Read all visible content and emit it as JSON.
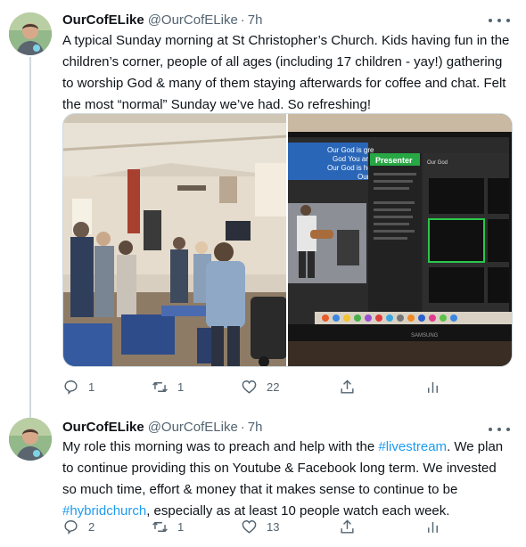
{
  "tweets": [
    {
      "author_name": "OurCofELike",
      "handle": "@OurCofELike",
      "separator": "·",
      "time": "7h",
      "text_lines": [
        "A typical Sunday morning at St Christopher’s Church. Kids having fun in the",
        "children’s corner, people of all ages (including 17 children - yay!) gathering",
        "to worship God & many of them staying afterwards for coffee and chat. Felt",
        "the most “normal” Sunday we’ve had. So refreshing!"
      ],
      "counts": {
        "replies": "1",
        "retweets": "1",
        "likes": "22"
      },
      "media": {
        "right_photo": {
          "screen_lyrics": [
            "Our God is gre",
            "God You are",
            "Our God is he",
            "Our"
          ],
          "presenter_label": "Presenter",
          "panel_label": "Our God",
          "monitor_brand": "SAMSUNG"
        }
      }
    },
    {
      "author_name": "OurCofELike",
      "handle": "@OurCofELike",
      "separator": "·",
      "time": "7h",
      "line1_a": "My role this morning was to preach and help with the ",
      "line1_tag": "#livestream",
      "line1_b": ". We plan",
      "line2": "to continue providing this on Youtube & Facebook long term. We invested",
      "line3": "so much time, effort & money that it makes sense to continue to be",
      "line4_tag": "#hybridchurch",
      "line4_b": ", especially as at least 10 people watch each week.",
      "counts": {
        "replies": "2",
        "retweets": "1",
        "likes": "13"
      }
    }
  ],
  "icons": {
    "reply": "reply-icon",
    "retweet": "retweet-icon",
    "like": "heart-icon",
    "share": "share-icon",
    "analytics": "analytics-icon",
    "more": "more-icon"
  },
  "colors": {
    "text": "#0f1419",
    "secondary": "#536471",
    "link": "#1d9bf0",
    "border": "#cfd9de"
  }
}
